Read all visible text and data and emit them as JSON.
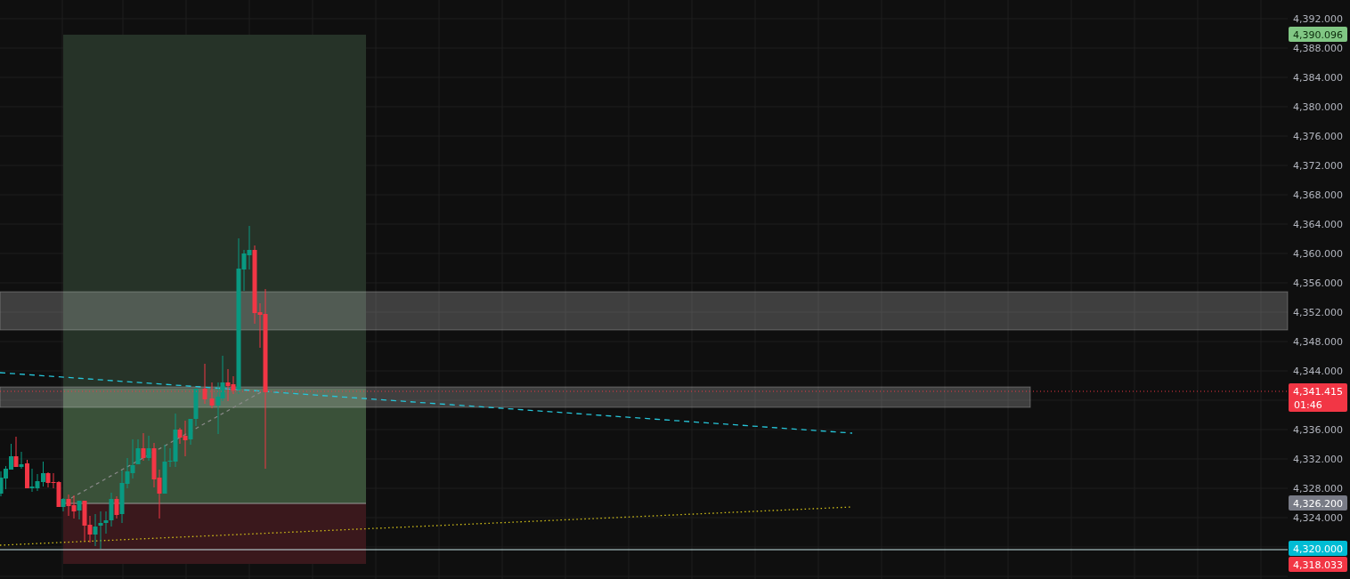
{
  "price_axis": {
    "ticks": [
      "4,392.000",
      "4,388.000",
      "4,384.000",
      "4,380.000",
      "4,376.000",
      "4,372.000",
      "4,368.000",
      "4,364.000",
      "4,360.000",
      "4,356.000",
      "4,352.000",
      "4,348.000",
      "4,344.000",
      "4,336.000",
      "4,332.000",
      "4,328.000",
      "4,324.000"
    ]
  },
  "price_tags": [
    {
      "label": "4,390.096",
      "color": "#81c784"
    },
    {
      "label": "4,341.415",
      "countdown": "01:46",
      "color": "#f23645"
    },
    {
      "label": "4,326.200",
      "color": "#787b86"
    },
    {
      "label": "4,320.000",
      "color": "#00bcd4"
    },
    {
      "label": "4,318.033",
      "color": "#f23645"
    }
  ]
}
